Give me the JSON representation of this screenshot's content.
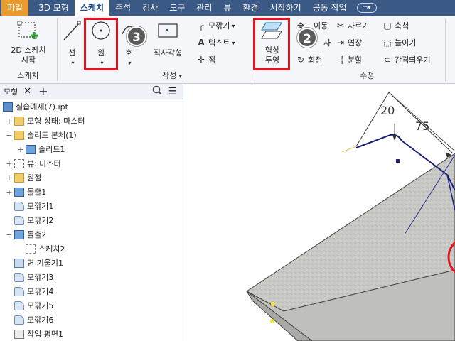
{
  "menubar": {
    "items": [
      "파일",
      "3D 모형",
      "스케치",
      "주석",
      "검사",
      "도구",
      "관리",
      "뷰",
      "환경",
      "시작하기",
      "공동 작업"
    ],
    "active": "스케치"
  },
  "ribbon": {
    "start_sketch": {
      "line1": "2D 스케치",
      "line2": "시작"
    },
    "group_sketch": "스케치",
    "line": "선",
    "circle": "원",
    "rectangle": "직사각형",
    "fillet": "모깎기",
    "text": "텍스트",
    "point": "점",
    "group_create": "작성",
    "project": {
      "line1": "형상",
      "line2": "투영"
    },
    "move": "이동",
    "copy": "사",
    "rotate": "회전",
    "trim": "자르기",
    "extend": "연장",
    "split": "분할",
    "scale": "축척",
    "stretch": "늘이기",
    "offset": "간격띄우기",
    "group_modify": "수정",
    "badge_project": "2",
    "badge_circle": "3"
  },
  "panel": {
    "tab": "모형",
    "tree": [
      {
        "label": "실습예제(7).ipt",
        "icon": "part",
        "indent": 0,
        "exp": ""
      },
      {
        "label": "모형 상태: 마스터",
        "icon": "folder",
        "indent": 1,
        "exp": "+"
      },
      {
        "label": "솔리드 본체(1)",
        "icon": "folder",
        "indent": 1,
        "exp": "−"
      },
      {
        "label": "솔리드1",
        "icon": "solid",
        "indent": 2,
        "exp": "+"
      },
      {
        "label": "뷰: 마스터",
        "icon": "view",
        "indent": 1,
        "exp": "+"
      },
      {
        "label": "원점",
        "icon": "folder",
        "indent": 1,
        "exp": "+"
      },
      {
        "label": "돌출1",
        "icon": "solid",
        "indent": 1,
        "exp": "+"
      },
      {
        "label": "모깎기1",
        "icon": "feat",
        "indent": 1,
        "exp": ""
      },
      {
        "label": "모깎기2",
        "icon": "feat",
        "indent": 1,
        "exp": ""
      },
      {
        "label": "돌출2",
        "icon": "solid",
        "indent": 1,
        "exp": "−"
      },
      {
        "label": "스케치2",
        "icon": "sketch",
        "indent": 2,
        "exp": ""
      },
      {
        "label": "면 기울기1",
        "icon": "revolve",
        "indent": 1,
        "exp": ""
      },
      {
        "label": "모깎기3",
        "icon": "feat",
        "indent": 1,
        "exp": ""
      },
      {
        "label": "모깎기4",
        "icon": "feat",
        "indent": 1,
        "exp": ""
      },
      {
        "label": "모깎기5",
        "icon": "feat",
        "indent": 1,
        "exp": ""
      },
      {
        "label": "모깎기6",
        "icon": "feat",
        "indent": 1,
        "exp": ""
      },
      {
        "label": "작업 평면1",
        "icon": "plane",
        "indent": 1,
        "exp": ""
      }
    ]
  },
  "viewport": {
    "dim1": "20",
    "dim2": "75"
  }
}
